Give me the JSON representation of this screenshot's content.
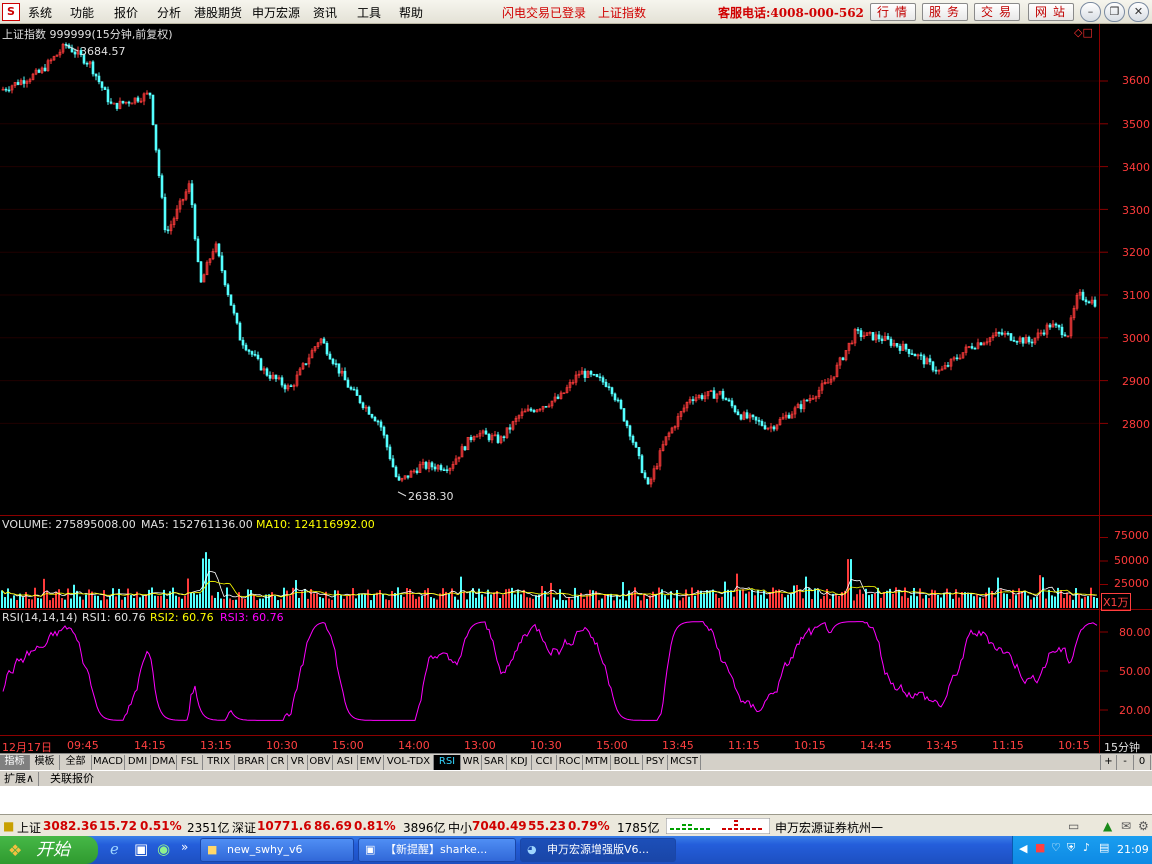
{
  "menu": {
    "logo": "S",
    "items": [
      "系统",
      "功能",
      "报价",
      "分析",
      "港股期货",
      "申万宏源",
      "资讯",
      "工具",
      "帮助"
    ],
    "notice1": "闪电交易已登录",
    "notice2": "上证指数",
    "hotline": "客服电话:4008-000-562",
    "buttons": [
      "行情",
      "服务",
      "交易",
      "网站"
    ]
  },
  "chart": {
    "title": "上证指数 999999(15分钟,前复权)",
    "high_label": "3684.57",
    "low_label": "2638.30",
    "price_ticks": [
      "3600",
      "3500",
      "3400",
      "3300",
      "3200",
      "3100",
      "3000",
      "2900",
      "2800"
    ],
    "volume": {
      "label": "VOLUME: 275895008.00",
      "ma5": "MA5: 152761136.00",
      "ma10": "MA10: 124116992.00",
      "ticks": [
        "75000",
        "50000",
        "25000"
      ],
      "unit": "X1万"
    },
    "rsi": {
      "label": "RSI(14,14,14)",
      "rsi1": "RSI1: 60.76",
      "rsi2": "RSI2: 60.76",
      "rsi3": "RSI3: 60.76",
      "ticks": [
        "80.00",
        "50.00",
        "20.00"
      ]
    },
    "time_axis": [
      "12月17日",
      "09:45",
      "14:15",
      "13:15",
      "10:30",
      "15:00",
      "14:00",
      "13:00",
      "10:30",
      "15:00",
      "13:45",
      "11:15",
      "10:15",
      "14:45",
      "13:45",
      "11:15",
      "10:15"
    ],
    "period": "15分钟"
  },
  "indicator_tabs": [
    "指标",
    "模板",
    "全部",
    "MACD",
    "DMI",
    "DMA",
    "FSL",
    "TRIX",
    "BRAR",
    "CR",
    "VR",
    "OBV",
    "ASI",
    "EMV",
    "VOL-TDX",
    "RSI",
    "WR",
    "SAR",
    "KDJ",
    "CCI",
    "ROC",
    "MTM",
    "BOLL",
    "PSY",
    "MCST"
  ],
  "active_tab": "RSI",
  "tab_controls": [
    "+",
    "-",
    "0"
  ],
  "sub_tabs": [
    "扩展∧",
    "关联报价"
  ],
  "status": {
    "sh_name": "上证",
    "sh_price": "3082.36",
    "sh_change": "15.72",
    "sh_pct": "0.51%",
    "sh_amount": "2351亿",
    "sz_name": "深证",
    "sz_price": "10771.6",
    "sz_change": "86.69",
    "sz_pct": "0.81%",
    "sz_amount": "3896亿",
    "zx_name": "中小",
    "zx_price": "7040.49",
    "zx_change": "55.23",
    "zx_pct": "0.79%",
    "zx_amount": "1785亿",
    "broker": "申万宏源证券杭州一"
  },
  "taskbar": {
    "start": "开始",
    "tasks": [
      "new_swhy_v6",
      "【新提醒】sharke...",
      "申万宏源增强版V6..."
    ],
    "clock": "21:09"
  },
  "colors": {
    "up": "#ff3b3b",
    "down": "#54ffff",
    "rsi": "#ff00ff",
    "ma10": "#ffff00",
    "grid": "#8b0000"
  }
}
